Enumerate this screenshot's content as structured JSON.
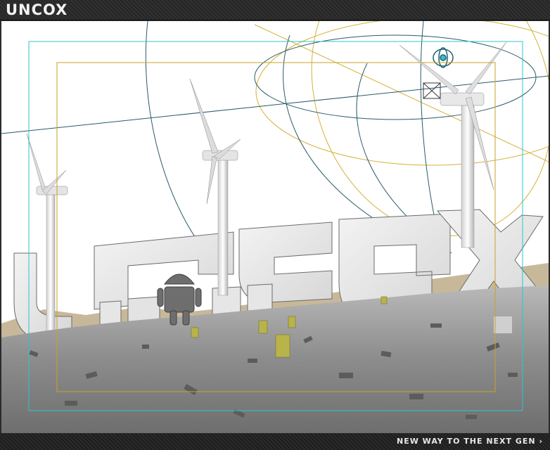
{
  "header": {
    "logo": "UNCOX"
  },
  "viewport": {
    "scene_logo": "UNCOX"
  },
  "footer": {
    "tagline": "NEW WAY TO THE NEXT GEN",
    "tagline_arrow": "›"
  },
  "colors": {
    "safe_frame": "#2fc4cc",
    "title_frame": "#c9a227",
    "light_gizmo": "#d4b23a",
    "camera_gizmo": "#2a5a6a"
  }
}
